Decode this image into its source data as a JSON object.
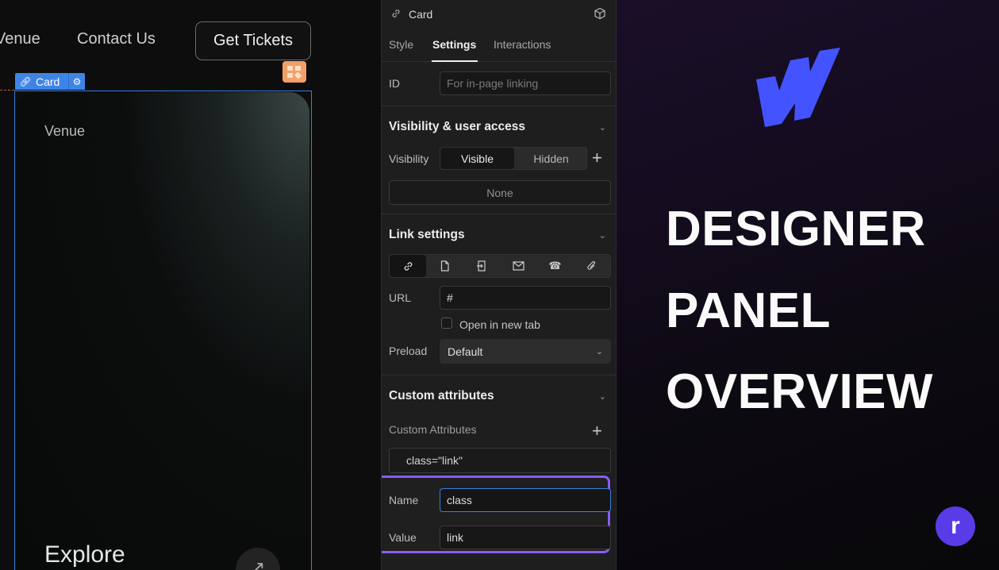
{
  "canvas": {
    "nav": {
      "venue": "Venue",
      "contact": "Contact Us",
      "tickets": "Get Tickets"
    },
    "selection_tag": {
      "label": "Card"
    },
    "card": {
      "heading": "Venue",
      "cta": "Explore"
    }
  },
  "panel": {
    "header": {
      "title": "Card"
    },
    "tabs": [
      "Style",
      "Settings",
      "Interactions"
    ],
    "active_tab": "Settings",
    "id_row": {
      "label": "ID",
      "placeholder": "For in-page linking"
    },
    "visibility_section": {
      "title": "Visibility & user access",
      "label": "Visibility",
      "options": [
        "Visible",
        "Hidden"
      ],
      "selected": "Visible",
      "access": "None"
    },
    "link_section": {
      "title": "Link settings",
      "link_types": [
        "url-link",
        "page",
        "page-section",
        "email",
        "phone",
        "file"
      ],
      "selected_type": "url-link",
      "url_label": "URL",
      "url_value": "#",
      "new_tab_label": "Open in new tab",
      "new_tab_checked": false,
      "preload_label": "Preload",
      "preload_value": "Default"
    },
    "custom_section": {
      "title": "Custom attributes",
      "list_label": "Custom Attributes",
      "items": [
        "class=\"link\""
      ],
      "name_label": "Name",
      "name_value": "class",
      "value_label": "Value",
      "value_value": "link"
    }
  },
  "banner": {
    "headline": [
      "DESIGNER",
      "PANEL",
      "OVERVIEW"
    ],
    "badge": "r",
    "logo_color": "#4353ff",
    "badge_color": "#5a3be8",
    "highlight_color": "#8a5cf6"
  }
}
